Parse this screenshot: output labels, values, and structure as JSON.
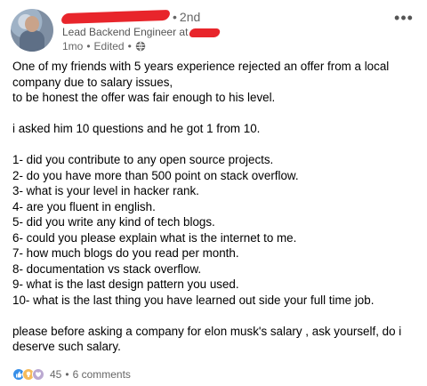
{
  "author": {
    "degree": "2nd",
    "headline": "Lead Backend Engineer at",
    "time": "1mo",
    "edited": "Edited"
  },
  "post": {
    "intro_lines": [
      "One of my friends with 5 years experience rejected an offer from a local",
      "company due to salary issues,",
      "to be honest the offer was fair enough to his level."
    ],
    "summary": "i asked him 10 questions and he got 1 from 10.",
    "questions": [
      "1- did you contribute to any open source projects.",
      "2- do you have more than 500 point on stack overflow.",
      "3- what is your level in hacker rank.",
      "4- are you fluent in english.",
      "5- did you write any kind of tech blogs.",
      "6- could you please explain what is the internet to me.",
      "7- how much blogs do you read per month.",
      "8- documentation vs stack overflow.",
      "9- what is the last design pattern you used.",
      "10- what is the last thing you have learned out side your full time job."
    ],
    "closing_lines": [
      "please before asking a company for elon musk's salary , ask yourself, do i",
      "deserve such salary."
    ]
  },
  "footer": {
    "reaction_count": "45",
    "comments": "6 comments",
    "separator": "•"
  },
  "icons": {
    "more": "ellipsis-icon",
    "visibility": "globe-icon"
  },
  "colors": {
    "redaction": "#e8252b",
    "like": "#378fe9",
    "insightful": "#f5bb5c",
    "support": "#bba9d1"
  }
}
